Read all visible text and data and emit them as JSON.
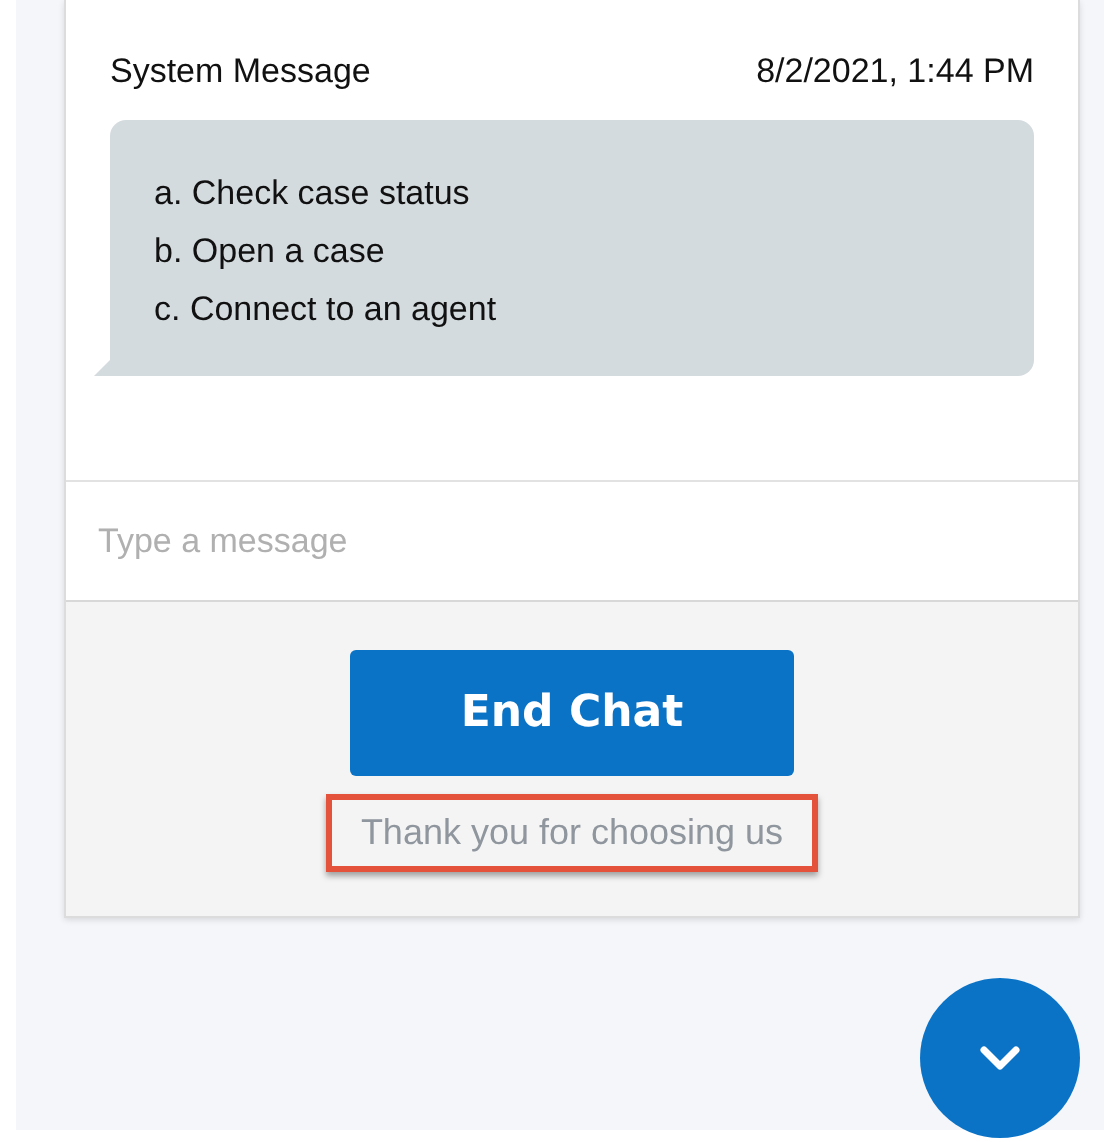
{
  "message": {
    "sender": "System Message",
    "time": "8/2/2021, 1:44 PM",
    "options": [
      "a. Check case status",
      "b. Open a case",
      "c. Connect to an agent"
    ]
  },
  "input": {
    "placeholder": "Type a message"
  },
  "end_button": "End Chat",
  "footer_note": "Thank you for choosing us"
}
